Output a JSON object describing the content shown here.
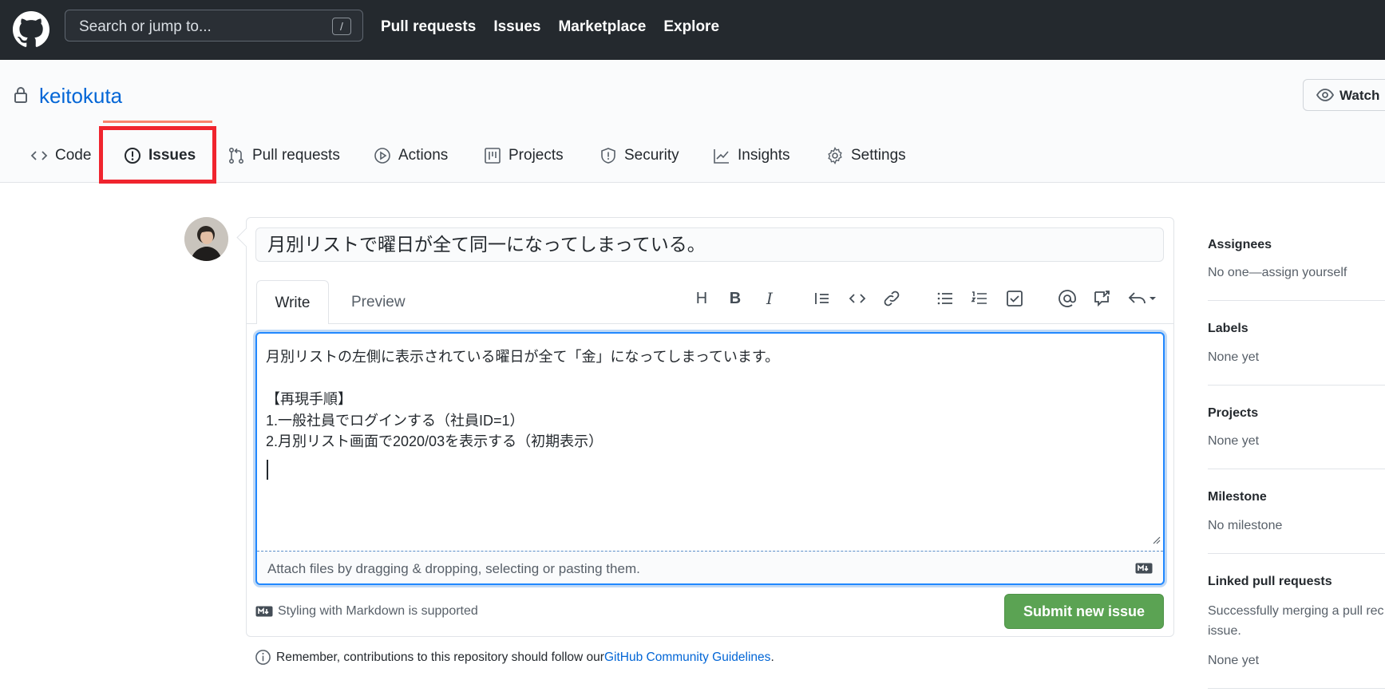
{
  "header": {
    "search_placeholder": "Search or jump to...",
    "search_shortcut": "/",
    "nav": [
      "Pull requests",
      "Issues",
      "Marketplace",
      "Explore"
    ]
  },
  "repo": {
    "name": "keitokuta",
    "watch_label": "Watch"
  },
  "tabs": {
    "code": "Code",
    "issues": "Issues",
    "pulls": "Pull requests",
    "actions": "Actions",
    "projects": "Projects",
    "security": "Security",
    "insights": "Insights",
    "settings": "Settings"
  },
  "form": {
    "title_value": "月別リストで曜日が全て同一になってしまっている。",
    "write_tab": "Write",
    "preview_tab": "Preview",
    "body_value": "月別リストの左側に表示されている曜日が全て「金」になってしまっています。\n\n【再現手順】\n1.一般社員でログインする（社員ID=1）\n2.月別リスト画面で2020/03を表示する（初期表示）",
    "attach_text": "Attach files by dragging & dropping, selecting or pasting them.",
    "markdown_note": "Styling with Markdown is supported",
    "submit_label": "Submit new issue",
    "guideline_prefix": "Remember, contributions to this repository should follow our ",
    "guideline_link": "GitHub Community Guidelines",
    "guideline_suffix": ".",
    "toolbar_icons": [
      "heading-icon",
      "bold-icon",
      "italic-icon",
      "quote-icon",
      "code-icon",
      "link-icon",
      "bulleted-list-icon",
      "numbered-list-icon",
      "task-list-icon",
      "mention-icon",
      "reference-icon",
      "reply-icon"
    ]
  },
  "sidebar": {
    "assignees_label": "Assignees",
    "assignees_value": "No one—assign yourself",
    "labels_label": "Labels",
    "labels_value": "None yet",
    "projects_label": "Projects",
    "projects_value": "None yet",
    "milestone_label": "Milestone",
    "milestone_value": "No milestone",
    "linked_label": "Linked pull requests",
    "linked_desc_1": "Successfully merging a pull rec",
    "linked_desc_2": "issue.",
    "linked_value": "None yet"
  },
  "colors": {
    "header_bg": "#24292e",
    "link": "#0366d6",
    "submit": "#5ba353",
    "highlight": "#f0242e"
  }
}
